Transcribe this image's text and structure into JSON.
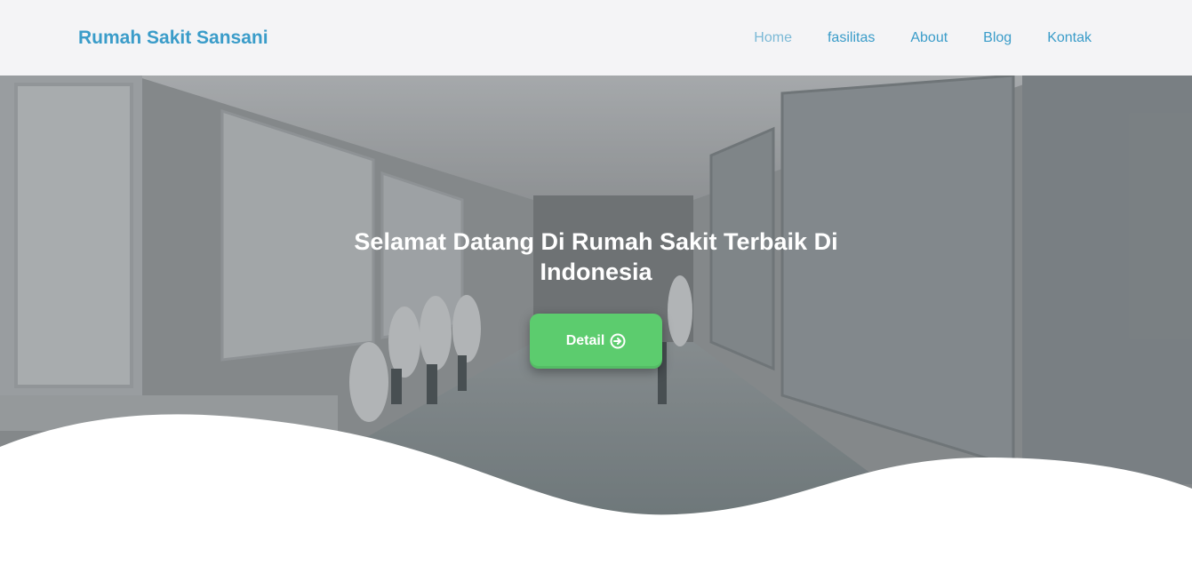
{
  "navbar": {
    "brand": "Rumah Sakit Sansani",
    "links": [
      {
        "label": "Home",
        "active": true
      },
      {
        "label": "fasilitas",
        "active": false
      },
      {
        "label": "About",
        "active": false
      },
      {
        "label": "Blog",
        "active": false
      },
      {
        "label": "Kontak",
        "active": false
      }
    ]
  },
  "hero": {
    "title": "Selamat Datang Di Rumah Sakit Terbaik Di Indonesia",
    "button_label": "Detail",
    "button_icon": "arrow-circle-right-icon",
    "background_image": "hospital-corridor-photo"
  },
  "colors": {
    "brand": "#3a9cc9",
    "nav_bg": "#f4f4f6",
    "button_green": "#5ccc6e",
    "overlay": "#7a7f84"
  }
}
